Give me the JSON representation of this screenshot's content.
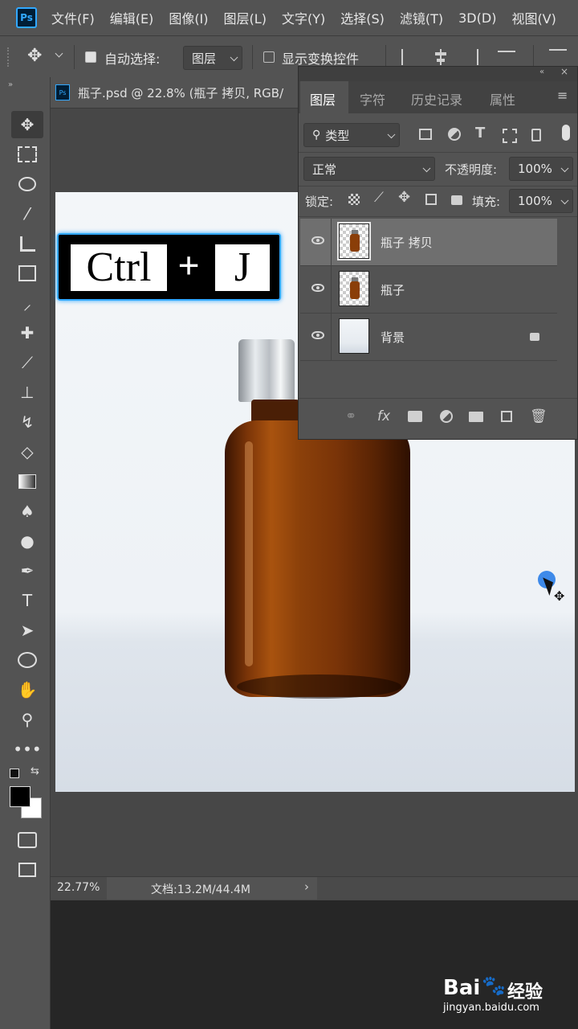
{
  "app": {
    "logo": "Ps"
  },
  "menu": [
    "文件(F)",
    "编辑(E)",
    "图像(I)",
    "图层(L)",
    "文字(Y)",
    "选择(S)",
    "滤镜(T)",
    "3D(D)",
    "视图(V)"
  ],
  "options": {
    "auto_select_label": "自动选择:",
    "auto_select_checked": true,
    "auto_select_target": "图层",
    "show_transform_label": "显示变换控件",
    "show_transform_checked": false
  },
  "document": {
    "tab_title": "瓶子.psd @ 22.8% (瓶子 拷贝, RGB/",
    "zoom": "22.77%",
    "doc_size": "文档:13.2M/44.4M"
  },
  "overlay": {
    "key1": "Ctrl",
    "plus": "+",
    "key2": "J"
  },
  "layers_panel": {
    "tabs": [
      "图层",
      "字符",
      "历史记录",
      "属性"
    ],
    "active_tab": "图层",
    "filter_label": "类型",
    "blend_mode": "正常",
    "opacity_label": "不透明度:",
    "opacity_value": "100%",
    "lock_label": "锁定:",
    "fill_label": "填充:",
    "fill_value": "100%",
    "layers": [
      {
        "name": "瓶子 拷贝",
        "selected": true,
        "locked": false
      },
      {
        "name": "瓶子",
        "selected": false,
        "locked": false
      },
      {
        "name": "背景",
        "selected": false,
        "locked": true
      }
    ]
  },
  "watermark": {
    "brand": "Bai",
    "brand2": "经验",
    "url": "jingyan.baidu.com"
  },
  "colors": {
    "panel_bg": "#535353",
    "workspace": "#474747",
    "selection_glow": "#31a8ff",
    "bottle": "#7a3408"
  }
}
